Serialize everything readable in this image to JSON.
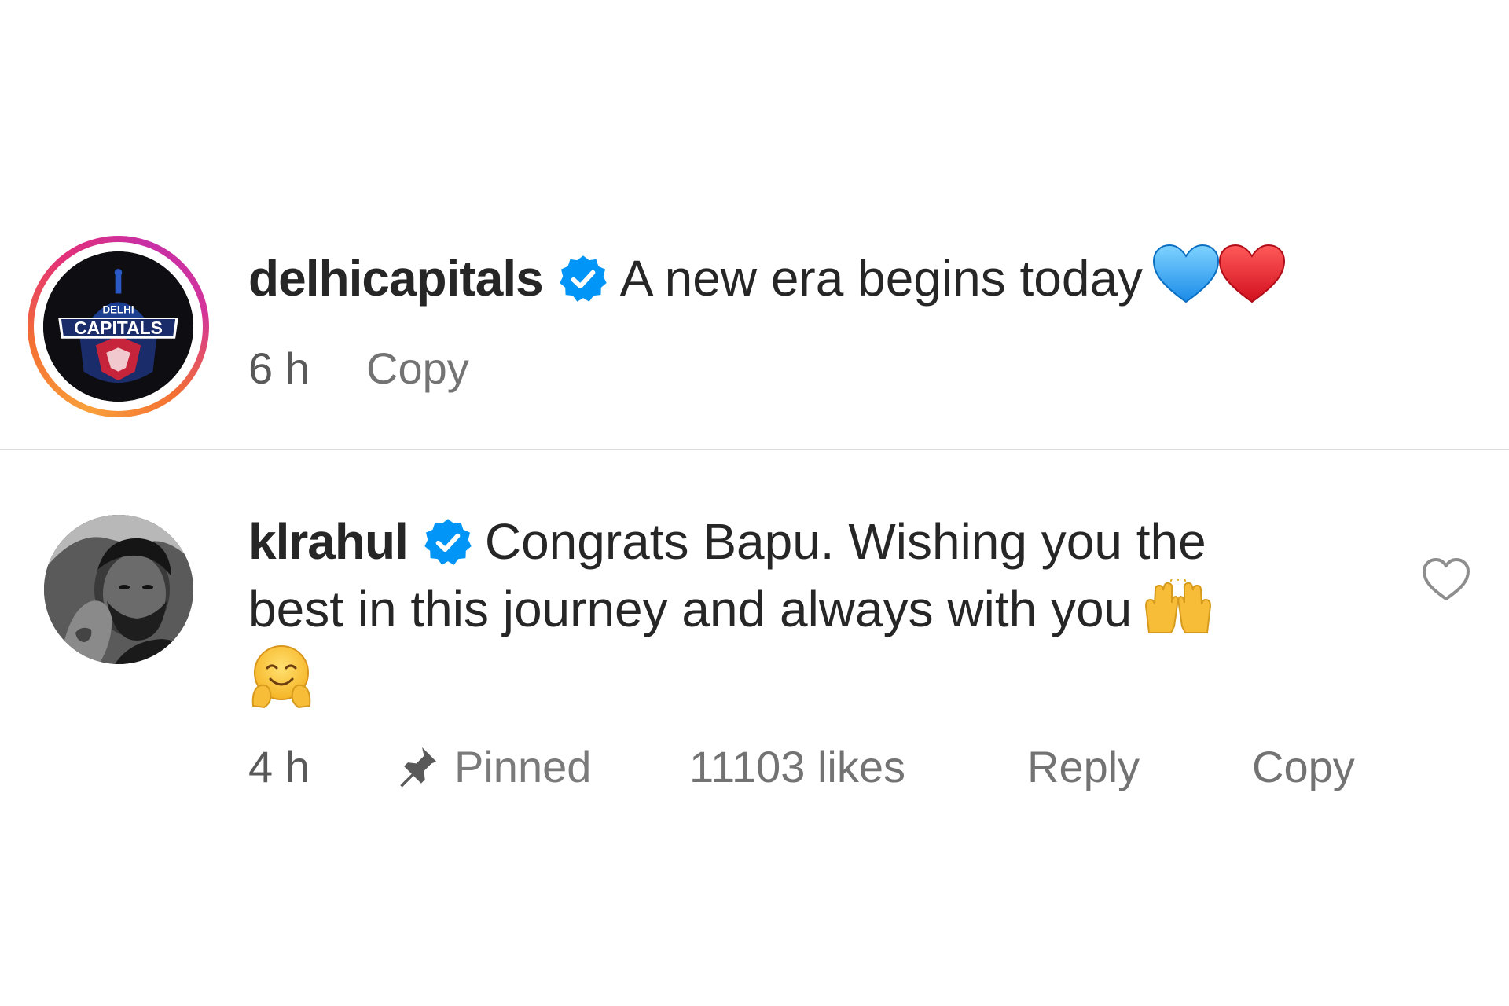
{
  "comments": [
    {
      "username": "delhicapitals",
      "verified": true,
      "text": "A new era begins today",
      "emoji": [
        "blue-heart",
        "red-heart"
      ],
      "avatar": {
        "type": "team-logo",
        "logo_text_top": "DELHI",
        "logo_text_main": "CAPITALS",
        "story_ring": true
      },
      "time": "6 h",
      "actions": [
        "Copy"
      ]
    },
    {
      "username": "klrahul",
      "verified": true,
      "text_line_1": "Congrats Bapu. Wishing you the",
      "text_line_2": "best in this journey and always with you",
      "emoji": [
        "raising-hands",
        "hugging-face"
      ],
      "avatar": {
        "type": "profile-photo"
      },
      "time": "4 h",
      "pinned_label": "Pinned",
      "likes_label": "11103 likes",
      "actions": [
        "Reply",
        "Copy"
      ],
      "like_icon": "heart-outline-icon"
    }
  ],
  "colors": {
    "text_primary": "#262626",
    "text_secondary": "#8e8e8e",
    "verified_blue": "#0095f6",
    "divider": "#dbdbdb",
    "background": "#ffffff"
  }
}
